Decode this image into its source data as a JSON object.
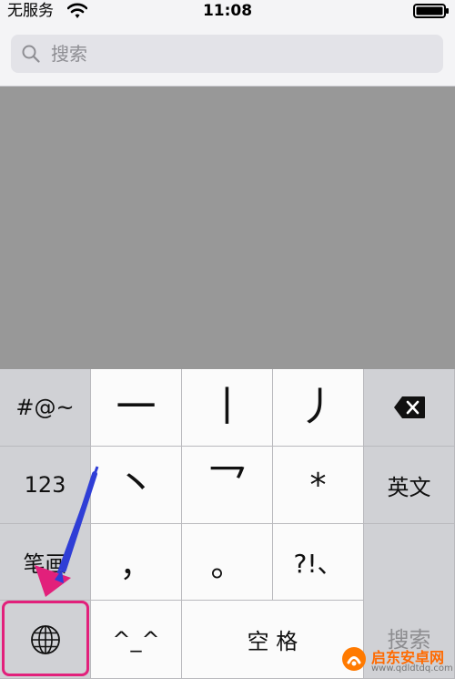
{
  "status_bar": {
    "carrier": "无服务",
    "time": "11:08",
    "wifi_icon": "wifi-icon",
    "battery_icon": "battery-icon"
  },
  "search": {
    "placeholder": "搜索",
    "icon": "search-icon"
  },
  "keyboard": {
    "left_column": {
      "symbols": "#@~",
      "numbers": "123",
      "strokes": "笔画",
      "globe_icon": "globe-icon"
    },
    "strokes": {
      "horizontal": "一",
      "vertical": "丨",
      "left_falling": "丿",
      "dot": "丶",
      "turning": "乛",
      "wildcard": "*"
    },
    "punctuation": {
      "comma": "，",
      "period": "。",
      "marks": "?!、"
    },
    "emoticon": "^_^",
    "space": "空 格",
    "right_column": {
      "delete_icon": "delete-icon",
      "english": "英文",
      "search": "搜索"
    }
  },
  "watermark": {
    "title": "启东安卓网",
    "url": "www.qdldtdq.com"
  },
  "colors": {
    "highlight": "#e2207b",
    "arrow": "#2f3ed6",
    "watermark": "#ff6a00"
  }
}
